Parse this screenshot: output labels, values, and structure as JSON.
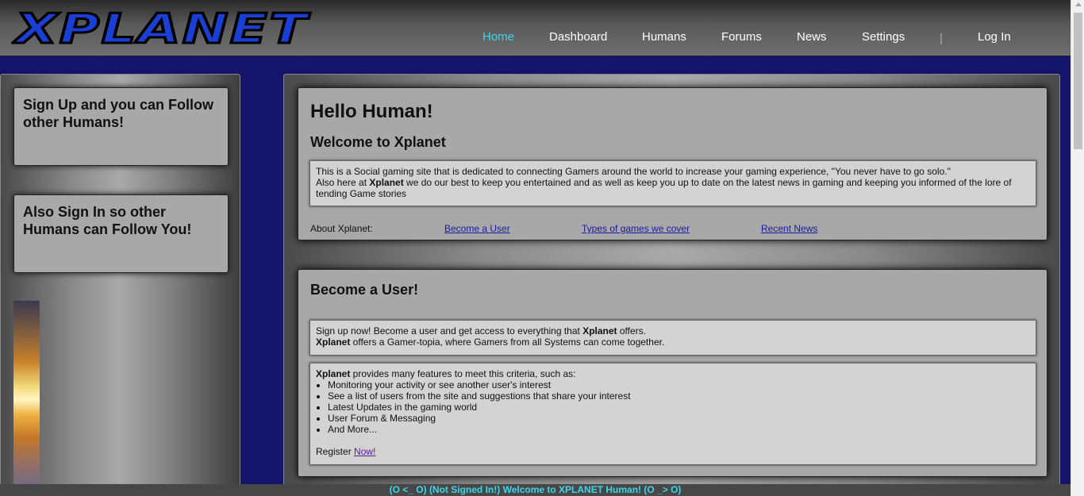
{
  "brand": {
    "logo_text": "XPLANET",
    "logo_color": "#1a3fd4",
    "accent": "#3fd6ea"
  },
  "nav": {
    "items": [
      {
        "label": "Home",
        "active": true
      },
      {
        "label": "Dashboard"
      },
      {
        "label": "Humans"
      },
      {
        "label": "Forums"
      },
      {
        "label": "News"
      },
      {
        "label": "Settings"
      }
    ],
    "separator": "|",
    "login_label": "Log In"
  },
  "sidebar": {
    "cards": [
      {
        "text": "Sign Up and you can Follow other Humans!"
      },
      {
        "text": "Also Sign In so other Humans can Follow You!"
      }
    ]
  },
  "welcome_panel": {
    "title": "Hello Human!",
    "subtitle": "Welcome to Xplanet",
    "intro_line1": "This is a Social gaming site that is dedicated to connecting Gamers around the world to increase your gaming experience, \"You never have to go solo.\"",
    "intro_line2_pre": "Also here at ",
    "intro_line2_brand": "Xplanet",
    "intro_line2_post": " we do our best to keep you entertained and as well as keep you up to date on the latest news in gaming and keeping you informed of the lore of tending Game stories",
    "about_label": "About Xplanet:",
    "about_links": [
      "Become a User",
      "Types of games we cover",
      "Recent News"
    ]
  },
  "become_user_panel": {
    "title": "Become a User!",
    "box1_line1_pre": "Sign up now! Become a user and get access to everything that ",
    "box1_line1_brand": "Xplanet",
    "box1_line1_post": " offers.",
    "box1_line2_brand": "Xplanet",
    "box1_line2_post": " offers a Gamer-topia, where Gamers from all Systems can come together.",
    "box2_intro_brand": "Xplanet",
    "box2_intro_post": " provides many features to meet this criteria, such as:",
    "features": [
      "Monitoring your activity or see another user's interest",
      "See a list of users from the site and suggestions that share your interest",
      "Latest Updates in the gaming world",
      "User Forum & Messaging",
      "And More..."
    ],
    "register_label": "Register ",
    "register_link": "Now!"
  },
  "statusbar": {
    "text": "(O <_ O) (Not Signed In!) Welcome to XPLANET Human! (O _> O)"
  }
}
